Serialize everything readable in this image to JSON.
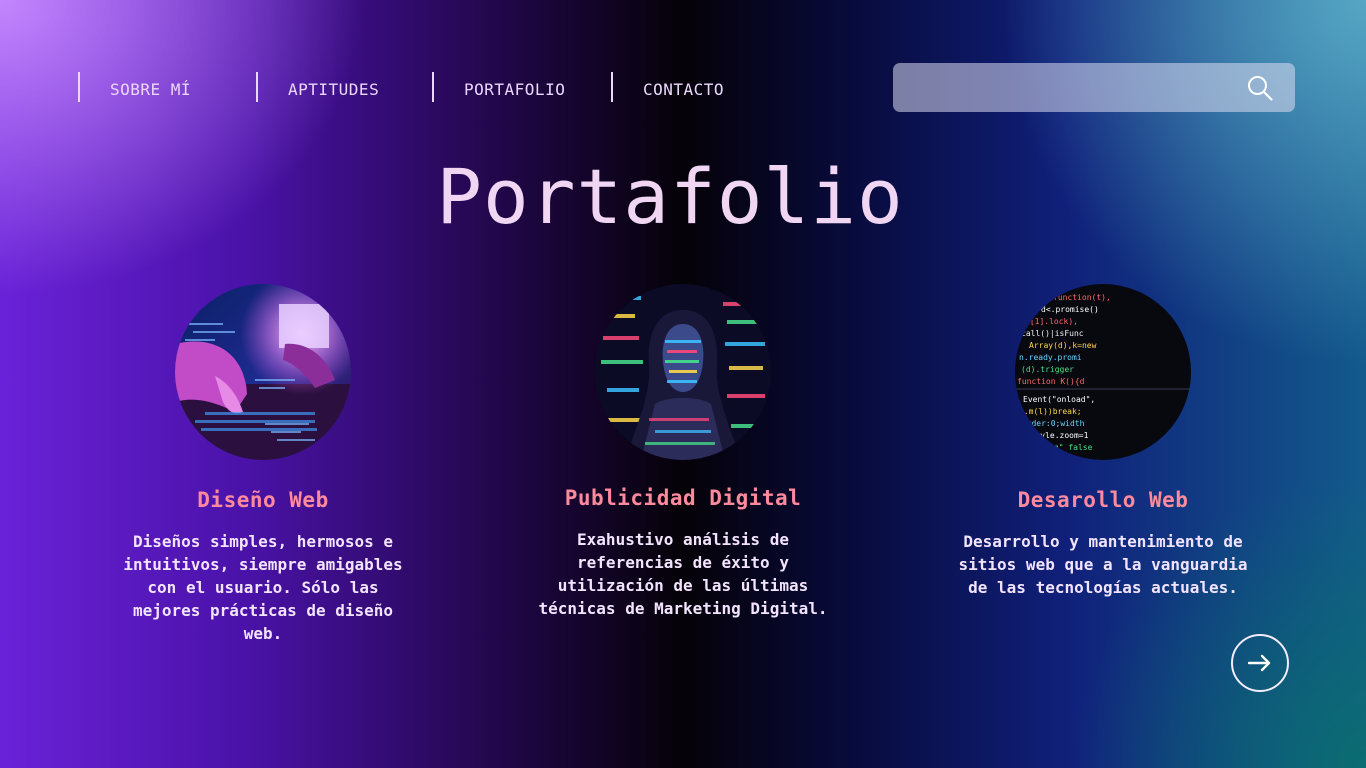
{
  "nav": {
    "items": [
      {
        "label": "SOBRE MÍ"
      },
      {
        "label": "APTITUDES"
      },
      {
        "label": "PORTAFOLIO"
      },
      {
        "label": "CONTACTO"
      }
    ]
  },
  "search": {
    "placeholder": "",
    "value": "",
    "icon": "search-icon"
  },
  "page": {
    "title": "Portafolio"
  },
  "cards": [
    {
      "title": "Diseño Web",
      "description": "Diseños simples, hermosos e intuitivos, siempre amigables con el usuario. Sólo las mejores prácticas de diseño web."
    },
    {
      "title": "Publicidad Digital",
      "description": "Exahustivo análisis de referencias de éxito y utilización de las últimas técnicas de Marketing Digital."
    },
    {
      "title": "Desarollo Web",
      "description": "Desarrollo y mantenimiento de sitios web que a la vanguardia de las tecnologías actuales."
    }
  ],
  "next": {
    "icon": "arrow-right-icon"
  },
  "colors": {
    "accent_title": "#ff8a9e",
    "heading": "#f1d6f4",
    "nav_text": "#ecd7ff"
  }
}
